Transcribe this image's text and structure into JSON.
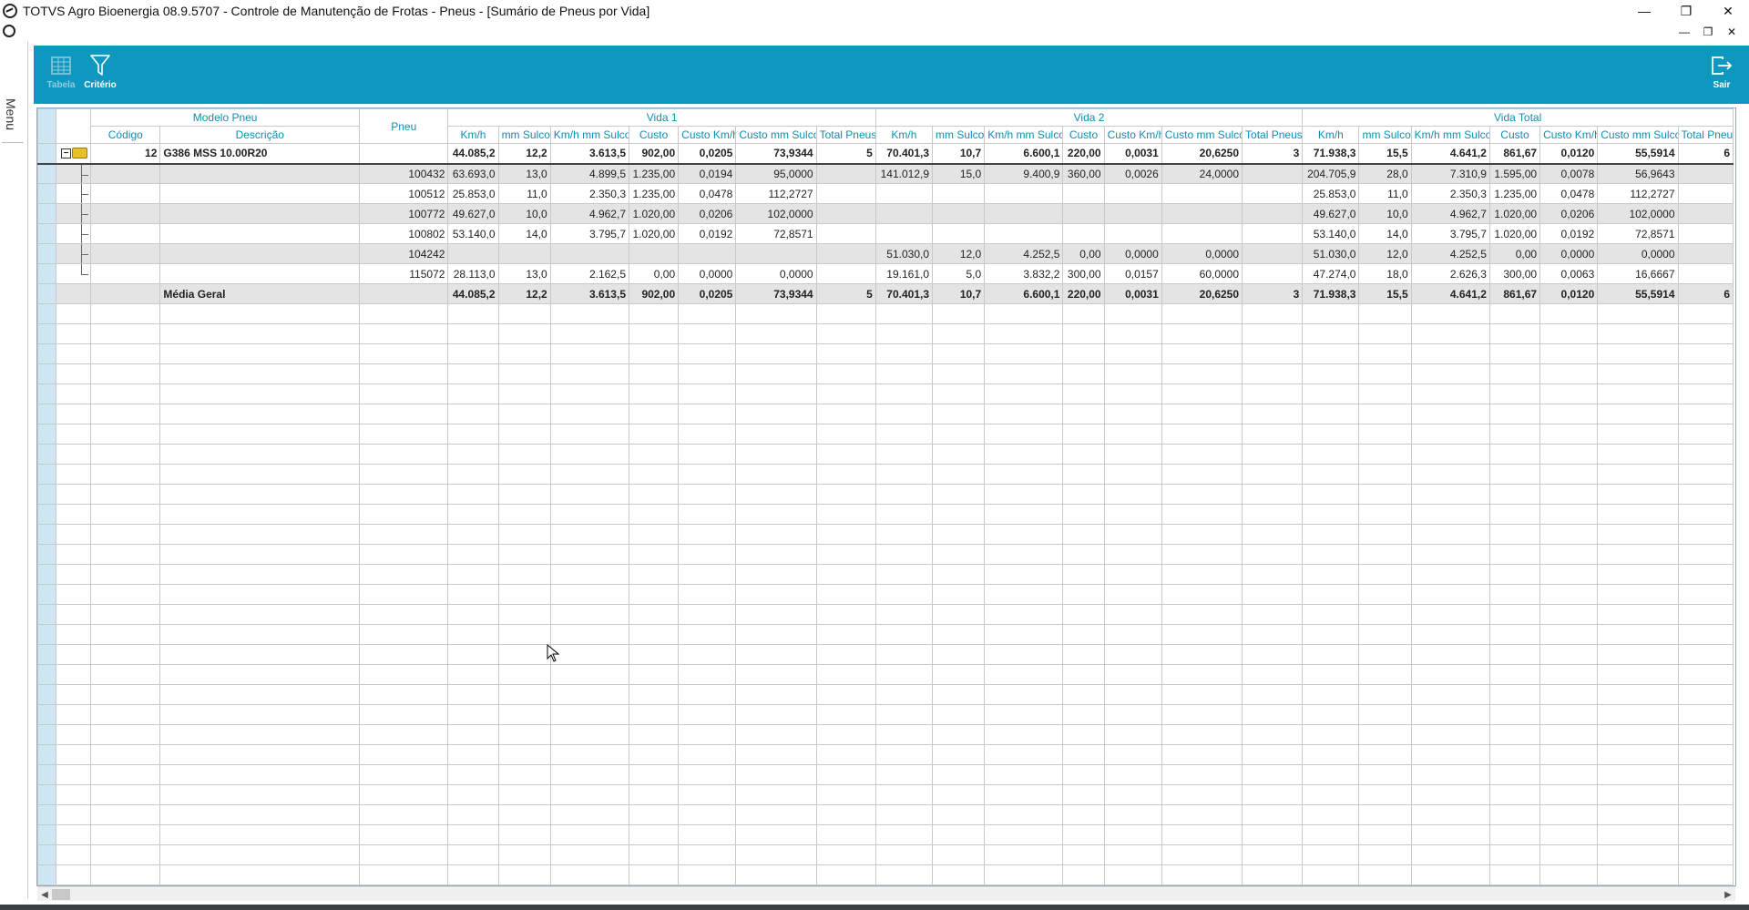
{
  "window": {
    "title": "TOTVS Agro Bioenergia 08.9.5707 - Controle de Manutenção de Frotas - Pneus - [Sumário de Pneus por Vida]",
    "minimize": "—",
    "maximize": "❐",
    "close": "✕"
  },
  "mdi": {
    "minimize": "—",
    "restore": "❐",
    "close": "✕"
  },
  "menu": {
    "label": "Menu"
  },
  "toolbar": {
    "tabela": "Tabela",
    "criterio": "Critério",
    "sair": "Sair"
  },
  "grid": {
    "group_headers": {
      "modelo": "Modelo Pneu",
      "pneu": "Pneu",
      "vida1": "Vida 1",
      "vida2": "Vida 2",
      "vidatotal": "Vida Total"
    },
    "sub_headers": {
      "codigo": "Código",
      "descricao": "Descrição",
      "metrics": [
        "Km/h",
        "mm Sulco",
        "Km/h mm Sulco",
        "Custo",
        "Custo Km/h",
        "Custo mm Sulco",
        "Total Pneus"
      ]
    },
    "group_row": {
      "codigo": "12",
      "descricao": "G386 MSS 10.00R20",
      "pneu": "",
      "v1": [
        "44.085,2",
        "12,2",
        "3.613,5",
        "902,00",
        "0,0205",
        "73,9344",
        "5"
      ],
      "v2": [
        "70.401,3",
        "10,7",
        "6.600,1",
        "220,00",
        "0,0031",
        "20,6250",
        "3"
      ],
      "vt": [
        "71.938,3",
        "15,5",
        "4.641,2",
        "861,67",
        "0,0120",
        "55,5914",
        "6"
      ]
    },
    "rows": [
      {
        "pneu": "100432",
        "shade": true,
        "v1": [
          "63.693,0",
          "13,0",
          "4.899,5",
          "1.235,00",
          "0,0194",
          "95,0000",
          ""
        ],
        "v2": [
          "141.012,9",
          "15,0",
          "9.400,9",
          "360,00",
          "0,0026",
          "24,0000",
          ""
        ],
        "vt": [
          "204.705,9",
          "28,0",
          "7.310,9",
          "1.595,00",
          "0,0078",
          "56,9643",
          ""
        ]
      },
      {
        "pneu": "100512",
        "shade": false,
        "v1": [
          "25.853,0",
          "11,0",
          "2.350,3",
          "1.235,00",
          "0,0478",
          "112,2727",
          ""
        ],
        "v2": [
          "",
          "",
          "",
          "",
          "",
          "",
          ""
        ],
        "vt": [
          "25.853,0",
          "11,0",
          "2.350,3",
          "1.235,00",
          "0,0478",
          "112,2727",
          ""
        ]
      },
      {
        "pneu": "100772",
        "shade": true,
        "v1": [
          "49.627,0",
          "10,0",
          "4.962,7",
          "1.020,00",
          "0,0206",
          "102,0000",
          ""
        ],
        "v2": [
          "",
          "",
          "",
          "",
          "",
          "",
          ""
        ],
        "vt": [
          "49.627,0",
          "10,0",
          "4.962,7",
          "1.020,00",
          "0,0206",
          "102,0000",
          ""
        ]
      },
      {
        "pneu": "100802",
        "shade": false,
        "v1": [
          "53.140,0",
          "14,0",
          "3.795,7",
          "1.020,00",
          "0,0192",
          "72,8571",
          ""
        ],
        "v2": [
          "",
          "",
          "",
          "",
          "",
          "",
          ""
        ],
        "vt": [
          "53.140,0",
          "14,0",
          "3.795,7",
          "1.020,00",
          "0,0192",
          "72,8571",
          ""
        ]
      },
      {
        "pneu": "104242",
        "shade": true,
        "v1": [
          "",
          "",
          "",
          "",
          "",
          "",
          ""
        ],
        "v2": [
          "51.030,0",
          "12,0",
          "4.252,5",
          "0,00",
          "0,0000",
          "0,0000",
          ""
        ],
        "vt": [
          "51.030,0",
          "12,0",
          "4.252,5",
          "0,00",
          "0,0000",
          "0,0000",
          ""
        ]
      },
      {
        "pneu": "115072",
        "shade": false,
        "v1": [
          "28.113,0",
          "13,0",
          "2.162,5",
          "0,00",
          "0,0000",
          "0,0000",
          ""
        ],
        "v2": [
          "19.161,0",
          "5,0",
          "3.832,2",
          "300,00",
          "0,0157",
          "60,0000",
          ""
        ],
        "vt": [
          "47.274,0",
          "18,0",
          "2.626,3",
          "300,00",
          "0,0063",
          "16,6667",
          ""
        ]
      }
    ],
    "total_row": {
      "label": "Média Geral",
      "v1": [
        "44.085,2",
        "12,2",
        "3.613,5",
        "902,00",
        "0,0205",
        "73,9344",
        "5"
      ],
      "v2": [
        "70.401,3",
        "10,7",
        "6.600,1",
        "220,00",
        "0,0031",
        "20,6250",
        "3"
      ],
      "vt": [
        "71.938,3",
        "15,5",
        "4.641,2",
        "861,67",
        "0,0120",
        "55,5914",
        "6"
      ]
    }
  }
}
